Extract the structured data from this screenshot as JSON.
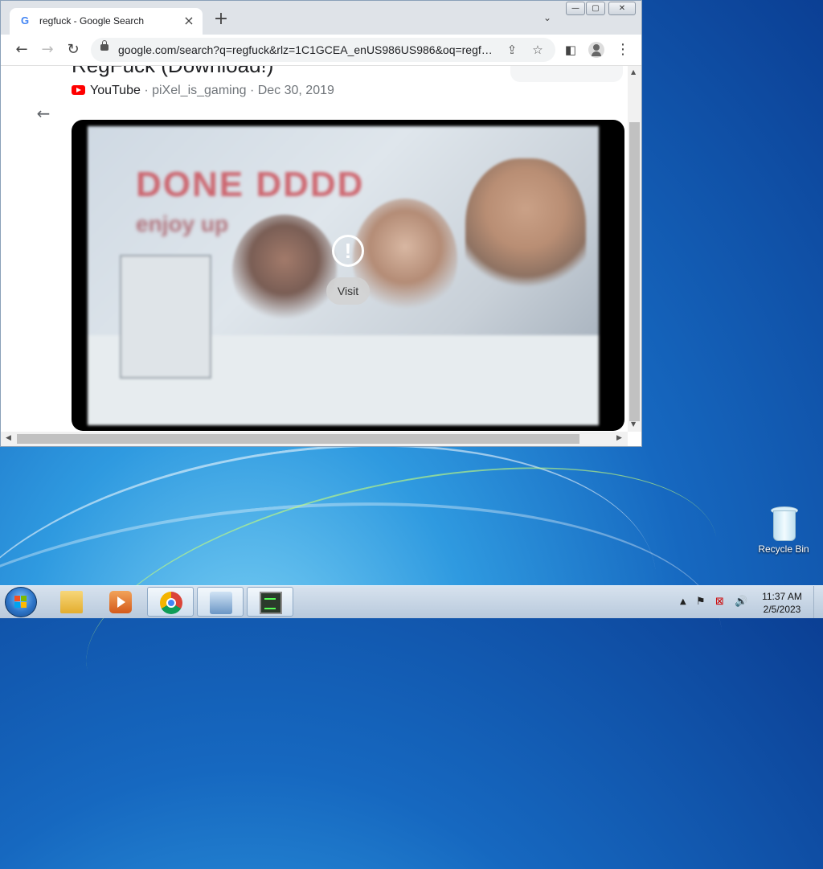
{
  "browser": {
    "tab_title": "regfuck - Google Search",
    "tab_favicon": "G",
    "new_tab_glyph": "+",
    "url": "google.com/search?q=regfuck&rlz=1C1GCEA_enUS986US986&oq=regfuc...",
    "window_controls": {
      "minimize": "▭",
      "maximize": "☐",
      "close": "✕"
    }
  },
  "result": {
    "title": "RegFuck (Download!)",
    "source": "YouTube",
    "meta": " · piXel_is_gaming · Dec 30, 2019",
    "video_overlay_text_1": "DONE   DDDD",
    "video_overlay_text_2": "enjoy  up",
    "warning_glyph": "!",
    "visit_label": "Visit"
  },
  "desktop": {
    "recycle_bin_label": "Recycle Bin"
  },
  "taskbar": {
    "time": "11:37 AM",
    "date": "2/5/2023",
    "items": [
      "windows-explorer",
      "media-player",
      "chrome",
      "on-screen-keyboard",
      "task-manager"
    ]
  },
  "colors": {
    "youtube_red": "#ff0000",
    "chrome_blue": "#4285f4",
    "desktop_blue": "#1668c0"
  }
}
